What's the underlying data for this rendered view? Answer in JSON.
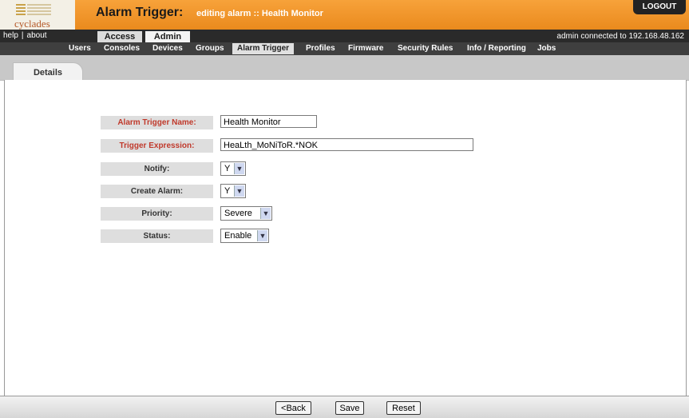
{
  "logo": {
    "text": "cyclades"
  },
  "header": {
    "title": "Alarm Trigger:",
    "subtitle": "editing alarm :: Health Monitor",
    "logout_label": "LOGOUT"
  },
  "topbar": {
    "help": "help",
    "separator": "|",
    "about": "about",
    "tabs": [
      {
        "label": "Access"
      },
      {
        "label": "Admin"
      }
    ],
    "status": "admin connected to 192.168.48.162"
  },
  "subnav": {
    "items": [
      {
        "label": "Users"
      },
      {
        "label": "Consoles"
      },
      {
        "label": "Devices"
      },
      {
        "label": "Groups"
      },
      {
        "label": "Alarm Trigger"
      },
      {
        "label": "Profiles"
      },
      {
        "label": "Firmware"
      },
      {
        "label": "Security Rules"
      },
      {
        "label": "Info / Reporting"
      },
      {
        "label": "Jobs"
      }
    ],
    "active": "Alarm Trigger"
  },
  "tabs": {
    "details": "Details"
  },
  "form": {
    "name": {
      "label": "Alarm Trigger Name:",
      "value": "Health Monitor"
    },
    "expression": {
      "label": "Trigger Expression:",
      "value": "HeaLth_MoNiToR.*NOK"
    },
    "notify": {
      "label": "Notify:",
      "value": "Y"
    },
    "create_alarm": {
      "label": "Create Alarm:",
      "value": "Y"
    },
    "priority": {
      "label": "Priority:",
      "value": "Severe"
    },
    "status": {
      "label": "Status:",
      "value": "Enable"
    }
  },
  "footer": {
    "back": "<Back",
    "save": "Save",
    "reset": "Reset"
  },
  "colors": {
    "header_orange": "#f09a2c",
    "required_label": "#c0392b"
  }
}
